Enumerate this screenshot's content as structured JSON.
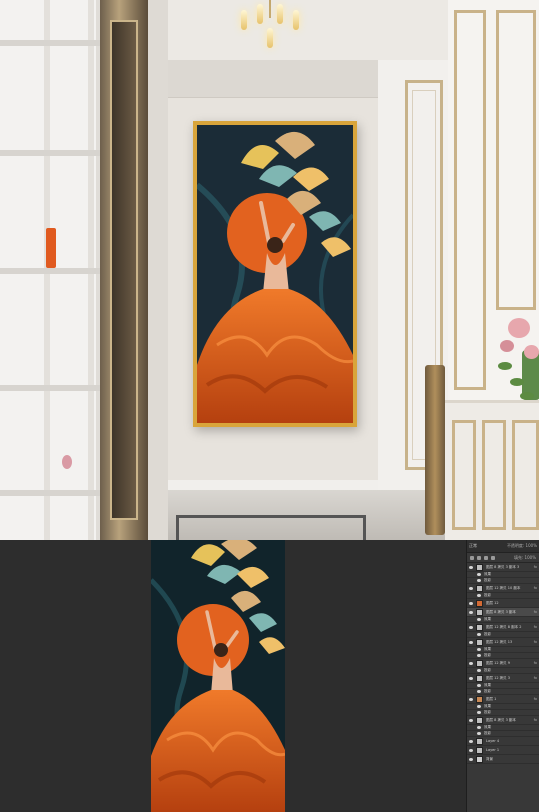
{
  "scene": {
    "frame_color": "#d9a53b",
    "accent_orange": "#e2621f",
    "background_teal": "#1e2e3a"
  },
  "artwork": {
    "subject": "ballerina-in-orange-gown",
    "sun_color": "#e2621f",
    "leaf_colors": [
      "#e6c25a",
      "#d9b07a",
      "#7fb6b2",
      "#efc069"
    ]
  },
  "layers_panel": {
    "title": "正常",
    "opacity_label": "不透明度: 100%",
    "fill_label": "填充: 100%",
    "rows": [
      {
        "name": "图层 8 拷贝 3 副本 3",
        "fx": "fx",
        "kind": "layer",
        "thumb": "#bfbfbf"
      },
      {
        "name": "效果",
        "kind": "sub"
      },
      {
        "name": "投影",
        "kind": "sub"
      },
      {
        "name": "图层 12 拷贝 10 副本",
        "fx": "fx",
        "kind": "layer",
        "thumb": "#bfbfbf"
      },
      {
        "name": "投影",
        "kind": "sub"
      },
      {
        "name": "图层 12",
        "fx": "",
        "kind": "layer",
        "thumb": "#d36a34"
      },
      {
        "name": "图层 8 拷贝 3 副本",
        "fx": "fx",
        "kind": "layer",
        "active": true,
        "thumb": "#bfbfbf"
      },
      {
        "name": "效果",
        "kind": "sub"
      },
      {
        "name": "图层 12 拷贝 8 副本 2",
        "fx": "fx",
        "kind": "layer",
        "thumb": "#bfbfbf"
      },
      {
        "name": "投影",
        "kind": "sub"
      },
      {
        "name": "图层 12 拷贝 13",
        "fx": "fx",
        "kind": "layer",
        "thumb": "#bfbfbf"
      },
      {
        "name": "效果",
        "kind": "sub"
      },
      {
        "name": "投影",
        "kind": "sub"
      },
      {
        "name": "图层 12 拷贝 9",
        "fx": "fx",
        "kind": "layer",
        "thumb": "#bfbfbf"
      },
      {
        "name": "投影",
        "kind": "sub"
      },
      {
        "name": "图层 12 拷贝 3",
        "fx": "fx",
        "kind": "layer",
        "thumb": "#bfbfbf"
      },
      {
        "name": "效果",
        "kind": "sub"
      },
      {
        "name": "投影",
        "kind": "sub"
      },
      {
        "name": "图层 1",
        "fx": "fx",
        "kind": "layer",
        "thumb": "#c98a56"
      },
      {
        "name": "效果",
        "kind": "sub"
      },
      {
        "name": "投影",
        "kind": "sub"
      },
      {
        "name": "图层 8 拷贝 3 副本",
        "fx": "fx",
        "kind": "layer",
        "thumb": "#bfbfbf"
      },
      {
        "name": "效果",
        "kind": "sub"
      },
      {
        "name": "投影",
        "kind": "sub"
      },
      {
        "name": "Layer 4",
        "fx": "",
        "kind": "layer",
        "thumb": "#bfbfbf"
      },
      {
        "name": "Layer 1",
        "fx": "",
        "kind": "layer",
        "thumb": "#bfbfbf"
      },
      {
        "name": "背景",
        "fx": "",
        "kind": "layer",
        "thumb": "#cfcfcf"
      }
    ]
  }
}
